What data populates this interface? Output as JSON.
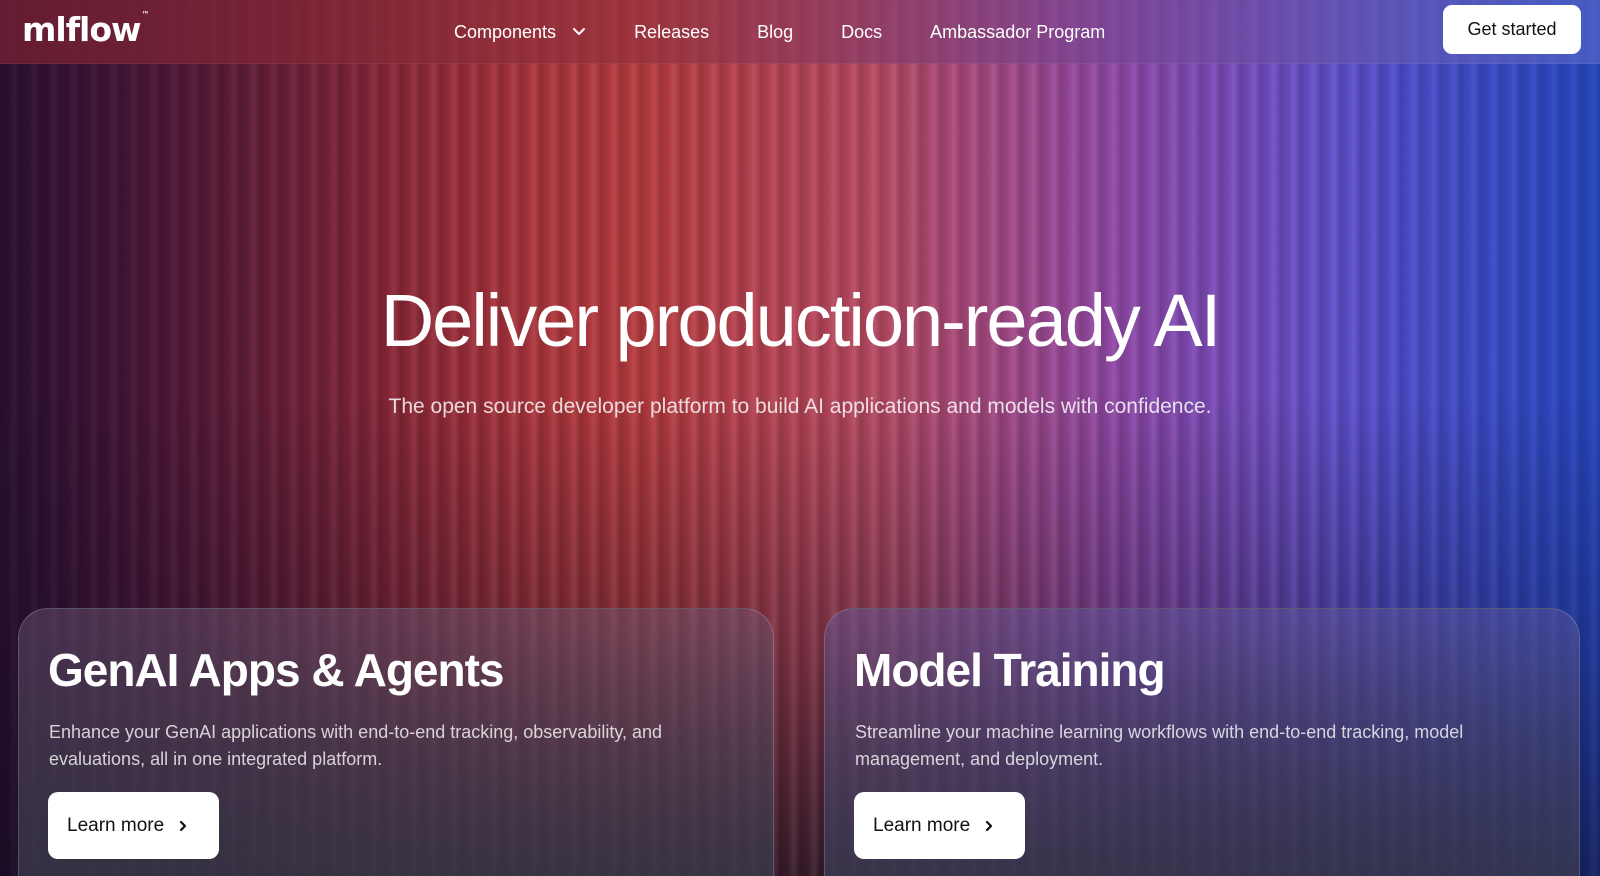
{
  "header": {
    "logo": "mlflow",
    "logo_tm": "™",
    "nav": [
      {
        "label": "Components",
        "has_dropdown": true
      },
      {
        "label": "Releases"
      },
      {
        "label": "Blog"
      },
      {
        "label": "Docs"
      },
      {
        "label": "Ambassador Program"
      }
    ],
    "cta_label": "Get started"
  },
  "hero": {
    "title": "Deliver production-ready AI",
    "subtitle": "The open source developer platform to build AI applications and models with confidence."
  },
  "cards": [
    {
      "title": "GenAI Apps & Agents",
      "description": "Enhance your GenAI applications with end-to-end tracking, observability, and evaluations, all in one integrated platform.",
      "button_label": "Learn more"
    },
    {
      "title": "Model Training",
      "description": "Streamline your machine learning workflows with end-to-end tracking, model management, and deployment.",
      "button_label": "Learn more"
    }
  ],
  "icons": {
    "dropdown": "chevron-down-icon",
    "card_arrow": "chevron-right-icon"
  }
}
